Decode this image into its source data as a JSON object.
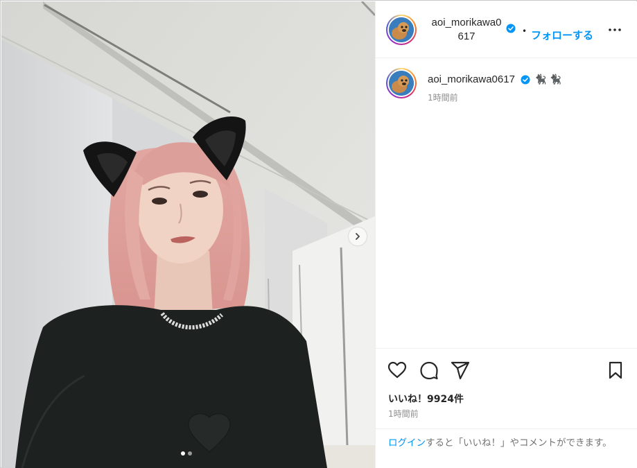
{
  "post": {
    "username": "aoi_morikawa0617",
    "header_name_line1": "aoi_morikawa0",
    "header_name_line2": "617",
    "separator": "•",
    "follow_label": "フォローする",
    "caption_emoji": "🐈‍⬛ 🐈‍⬛",
    "caption_time": "1時間前",
    "likes_text": "いいね！9924件",
    "post_time": "1時間前",
    "login_link": "ログイン",
    "login_prompt": "すると「いいね！」やコメントができます。",
    "carousel_position": 1,
    "carousel_count": 2
  },
  "icons": {
    "verified": "verified-badge-icon",
    "more": "more-options-icon",
    "like": "heart-icon",
    "comment": "comment-icon",
    "share": "share-icon",
    "save": "bookmark-icon",
    "next": "chevron-right-icon"
  },
  "colors": {
    "link_blue": "#0095f6",
    "verified_blue": "#0095f6",
    "text_primary": "#262626",
    "text_secondary": "#8e8e8e"
  }
}
